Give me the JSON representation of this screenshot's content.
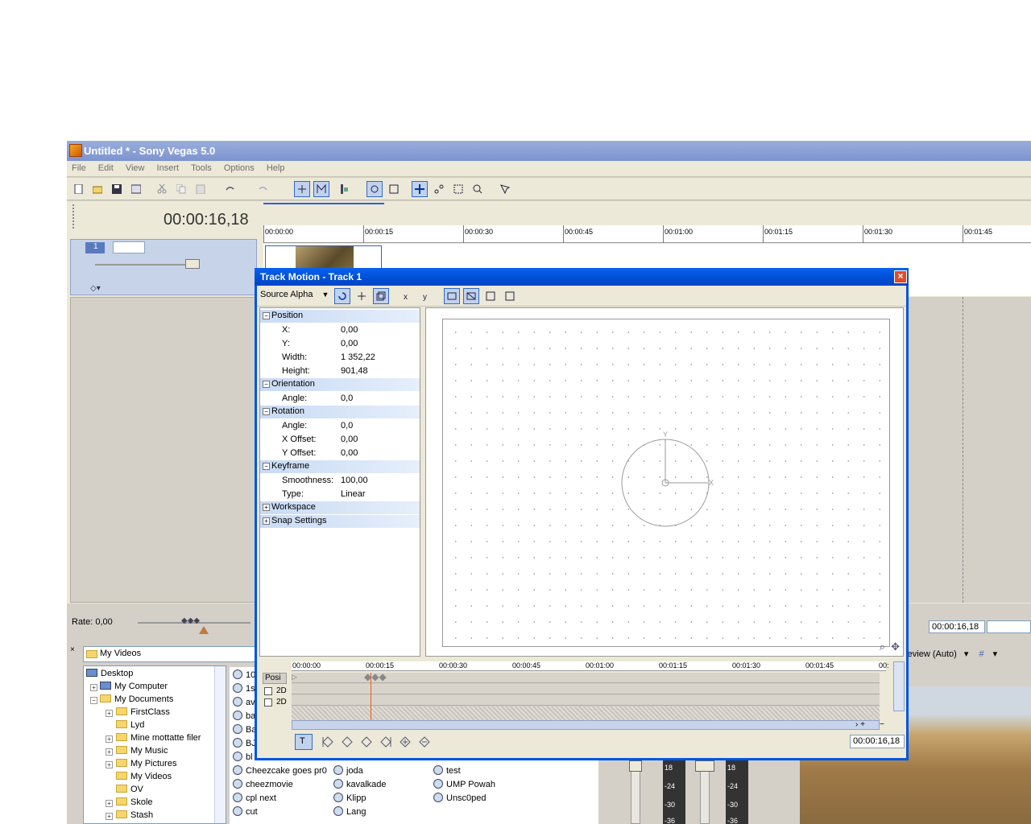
{
  "main": {
    "title": "Untitled * - Sony Vegas 5.0",
    "menu": [
      "File",
      "Edit",
      "View",
      "Insert",
      "Tools",
      "Options",
      "Help"
    ],
    "time_display": "00:00:16,18",
    "track_number": "1",
    "rate_label": "Rate: 0,00",
    "ruler_labels": [
      "00:00:00",
      "00:00:15",
      "00:00:30",
      "00:00:45",
      "00:01:00",
      "00:01:15",
      "00:01:30",
      "00:01:45"
    ],
    "right_time": "00:00:16,18",
    "preview_label": "review (Auto)",
    "explorer": {
      "path": "My Videos",
      "tree": [
        {
          "label": "Desktop",
          "icon": "desktop-icon"
        },
        {
          "label": "My Computer",
          "icon": "computer-icon"
        },
        {
          "label": "My Documents",
          "icon": "folder-icon"
        },
        {
          "label": "FirstClass",
          "icon": "folder-icon"
        },
        {
          "label": "Lyd",
          "icon": "folder-icon"
        },
        {
          "label": "Mine mottatte filer",
          "icon": "folder-icon"
        },
        {
          "label": "My Music",
          "icon": "folder-icon"
        },
        {
          "label": "My Pictures",
          "icon": "folder-icon"
        },
        {
          "label": "My Videos",
          "icon": "folder-icon"
        },
        {
          "label": "OV",
          "icon": "folder-icon"
        },
        {
          "label": "Skole",
          "icon": "folder-icon"
        },
        {
          "label": "Stash",
          "icon": "folder-icon"
        }
      ],
      "files_col1": [
        "10",
        "1s",
        "av",
        "ba",
        "Ba",
        "BJ",
        "bl",
        "Cheezcake goes pr0",
        "cheezmovie",
        "cpl next",
        "cut"
      ],
      "files_col2": [
        "joda",
        "kavalkade",
        "Klipp",
        "Lang"
      ],
      "files_col3": [
        "test",
        "UMP Powah",
        "Unsc0ped"
      ]
    },
    "mixer_labels": [
      "18",
      "-24",
      "-30",
      "-36",
      "18",
      "-24",
      "-30",
      "-36"
    ]
  },
  "dialog": {
    "title": "Track Motion - Track 1",
    "source_alpha": "Source Alpha",
    "groups": {
      "position": "Position",
      "orientation": "Orientation",
      "rotation": "Rotation",
      "keyframe": "Keyframe",
      "workspace": "Workspace",
      "snap": "Snap Settings"
    },
    "props": {
      "x_label": "X:",
      "x_value": "0,00",
      "y_label": "Y:",
      "y_value": "0,00",
      "width_label": "Width:",
      "width_value": "1 352,22",
      "height_label": "Height:",
      "height_value": "901,48",
      "orient_angle_label": "Angle:",
      "orient_angle_value": "0,0",
      "rot_angle_label": "Angle:",
      "rot_angle_value": "0,0",
      "xoff_label": "X Offset:",
      "xoff_value": "0,00",
      "yoff_label": "Y Offset:",
      "yoff_value": "0,00",
      "smooth_label": "Smoothness:",
      "smooth_value": "100,00",
      "type_label": "Type:",
      "type_value": "Linear"
    },
    "canvas_labels": {
      "y": "Y",
      "x": "X"
    },
    "keyframe_ruler": [
      "00:00:00",
      "00:00:15",
      "00:00:30",
      "00:00:45",
      "00:01:00",
      "00:01:15",
      "00:01:30",
      "00:01:45",
      "00:"
    ],
    "lane_header": "Posi",
    "lane_rows": [
      "2D",
      "2D"
    ],
    "time": "00:00:16,18"
  },
  "colors": {
    "xp_blue": "#0054e3",
    "inactive_title": "#7d93cf",
    "selection": "#c1d2ee"
  }
}
